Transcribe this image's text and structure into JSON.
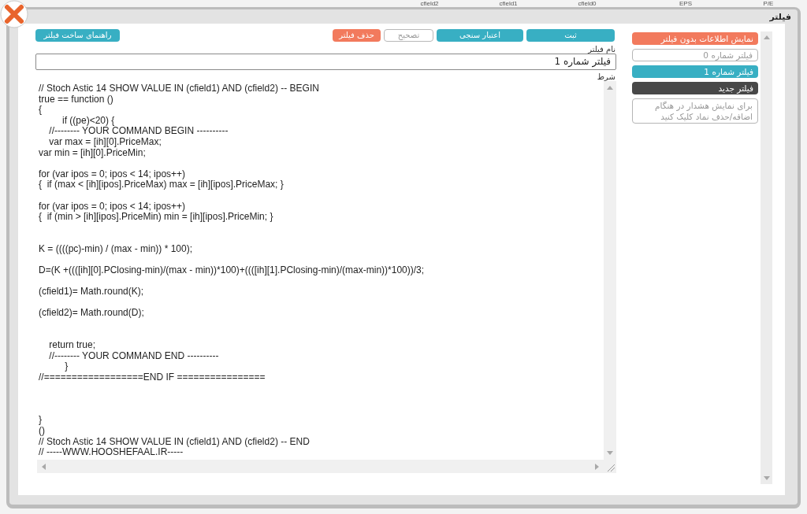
{
  "background_table": {
    "columns": [
      "P/E",
      "EPS",
      "cfield0",
      "cfield1",
      "cfield2"
    ]
  },
  "dialog": {
    "title": "فیلتر"
  },
  "toolbar": {
    "help_button": {
      "label": "راهنمای ساخت فیلتر"
    },
    "buttons": [
      {
        "label": "ثبت",
        "kind": "primary",
        "disabled": false
      },
      {
        "label": "اعتبار سنجی",
        "kind": "primary",
        "disabled": false
      },
      {
        "label": "تصحیح",
        "kind": "primary",
        "disabled": true
      },
      {
        "label": "حذف فیلتر",
        "kind": "danger",
        "disabled": false
      }
    ]
  },
  "name_field": {
    "label": "نام فیلتر",
    "value": "فیلتر شماره 1"
  },
  "condition_field": {
    "label": "شرط",
    "value": "// Stoch Astic 14 SHOW VALUE IN (cfield1) AND (cfield2) -- BEGIN\ntrue == function ()\n{\n         if ((pe)<20) {\n    //-------- YOUR COMMAND BEGIN ----------\n    var max = [ih][0].PriceMax;\nvar min = [ih][0].PriceMin;\n\nfor (var ipos = 0; ipos < 14; ipos++)\n{  if (max < [ih][ipos].PriceMax) max = [ih][ipos].PriceMax; }\n\nfor (var ipos = 0; ipos < 14; ipos++)\n{  if (min > [ih][ipos].PriceMin) min = [ih][ipos].PriceMin; }\n\n\nK = ((((pc)-min) / (max - min)) * 100);\n\nD=(K +((([ih][0].PClosing-min)/(max - min))*100)+((([ih][1].PClosing-min)/(max-min))*100))/3;\n\n(cfield1)= Math.round(K);\n\n(cfield2)= Math.round(D);\n\n\n    return true;\n    //-------- YOUR COMMAND END ----------\n          }\n//==================END IF ================\n\n\n\n}\n()\n// Stoch Astic 14 SHOW VALUE IN (cfield1) AND (cfield2) -- END\n// -----WWW.HOOSHEFAAL.IR-----"
  },
  "filter_list": {
    "items": [
      {
        "label": "نمایش اطلاعات بدون فیلتر",
        "kind": "action",
        "selected": false
      },
      {
        "label": "فیلتر شماره 0",
        "kind": "filter",
        "selected": false
      },
      {
        "label": "فیلتر شماره 1",
        "kind": "filter",
        "selected": true
      },
      {
        "label": "فیلتر جدید",
        "kind": "new",
        "selected": false
      },
      {
        "label": "برای نمایش هشدار در هنگام اضافه/حذف نماد کلیک کنید",
        "kind": "hint",
        "selected": false
      }
    ]
  }
}
